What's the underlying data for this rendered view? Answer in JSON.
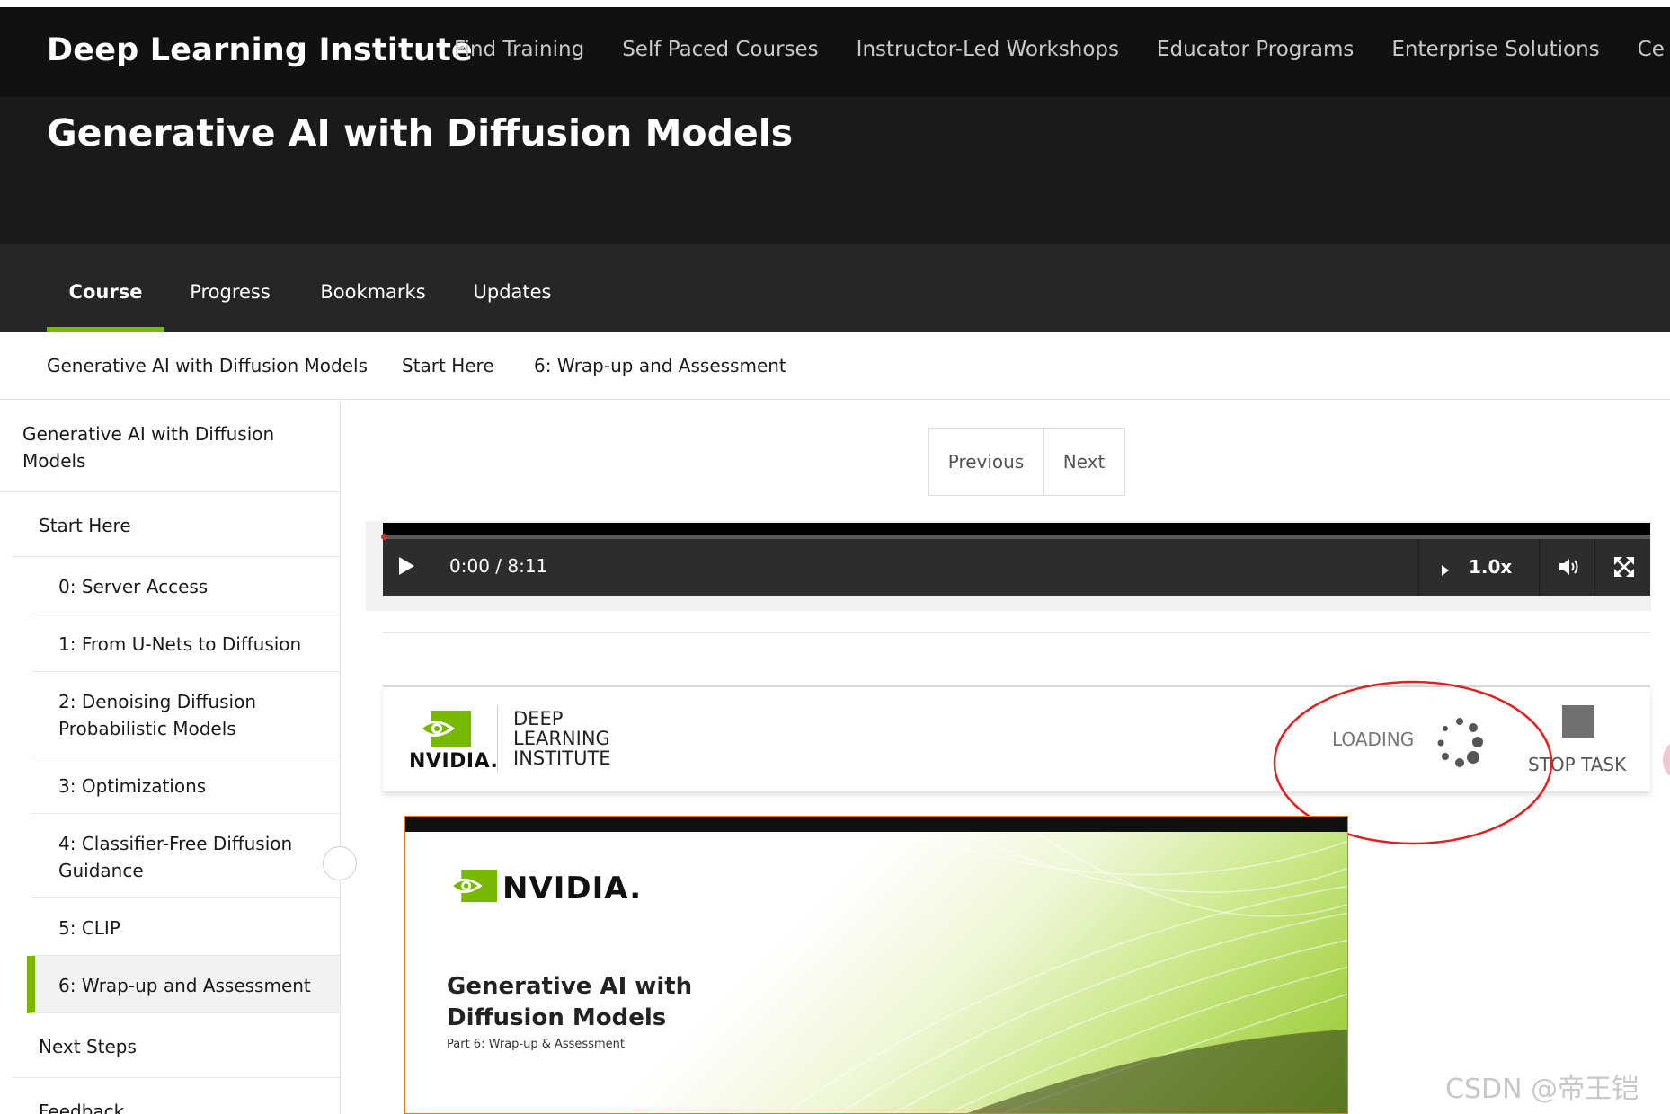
{
  "topnav": {
    "brand": "Deep Learning Institute",
    "links": [
      "Find Training",
      "Self Paced Courses",
      "Instructor-Led Workshops",
      "Educator Programs",
      "Enterprise Solutions",
      "Ce"
    ]
  },
  "hero": {
    "title": "Generative AI with Diffusion Models"
  },
  "tabs": [
    "Course",
    "Progress",
    "Bookmarks",
    "Updates"
  ],
  "breadcrumb": [
    "Generative AI with Diffusion Models",
    "Start Here",
    "6: Wrap-up and Assessment"
  ],
  "sidebar": {
    "course_line1": "Generative AI with Diffusion",
    "course_line2": "Models",
    "start_here": "Start Here",
    "items": {
      "i0": "0: Server Access",
      "i1": "1: From U-Nets to Diffusion",
      "i2a": "2: Denoising Diffusion",
      "i2b": "Probabilistic Models",
      "i3": "3: Optimizations",
      "i4a": "4: Classifier-Free Diffusion",
      "i4b": "Guidance",
      "i5": "5: CLIP",
      "i6": "6: Wrap-up and Assessment"
    },
    "next_steps": "Next Steps",
    "feedback": "Feedback"
  },
  "pager": {
    "previous": "Previous",
    "next": "Next"
  },
  "video": {
    "time": "0:00 / 8:11",
    "speed": "1.0x",
    "progress_fraction": 0
  },
  "task": {
    "logo_word": "NVIDIA.",
    "dli_line1": "DEEP",
    "dli_line2": "LEARNING",
    "dli_line3": "INSTITUTE",
    "loading": "LOADING",
    "stop": "STOP TASK"
  },
  "slide": {
    "brand": "NVIDIA.",
    "title_line1": "Generative AI with",
    "title_line2": "Diffusion Models",
    "subtitle": "Part 6: Wrap-up & Assessment"
  },
  "watermark": "CSDN @帝王铠",
  "colors": {
    "accent": "#76b900",
    "header_bg": "#111111",
    "annotation": "#e02020"
  }
}
